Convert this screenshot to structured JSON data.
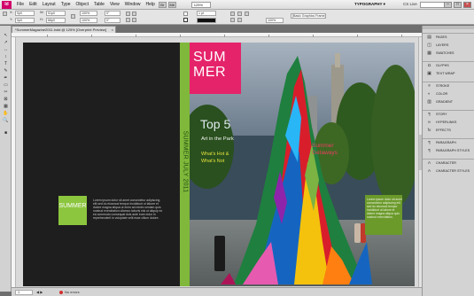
{
  "app": {
    "logo": "Id"
  },
  "menu": [
    "File",
    "Edit",
    "Layout",
    "Type",
    "Object",
    "Table",
    "View",
    "Window",
    "Help"
  ],
  "bridge": [
    "Br",
    "Mb"
  ],
  "zoom": "125%",
  "workspace": "TYPOGRAPHY ▾",
  "live": "CS Live",
  "window_buttons": [
    "–",
    "□",
    "×"
  ],
  "control_panel": {
    "ref_x": "0p0",
    "ref_y": "0p0",
    "w": "51p0",
    "h": "66p0",
    "scale_x": "100%",
    "scale_y": "100%",
    "angle": "0°",
    "shear": "0°",
    "stroke_weight": "1 pt",
    "frame_style": "[Basic Graphics Frame]",
    "zoom2": "100%"
  },
  "document_tab": {
    "title": "*SummerMagazine2011.indd @ 125% [Overprint Preview]",
    "close": "×"
  },
  "tools": [
    "↖",
    "↗",
    "↔",
    "↕",
    "T",
    "✎",
    "✒",
    "▭",
    "✂",
    "⊠",
    "▦",
    "✋",
    "🔍",
    "■"
  ],
  "back_cover": {
    "summer_box": "SUMMER",
    "copy": "Lorem ipsum dolor sit amet consectetur adipiscing elit sed do eiusmod tempor incididunt ut labore et dolore magna aliqua ut enim ad minim veniam quis nostrud exercitation ullamco laboris nisi ut aliquip ex ea commodo consequat duis aute irure dolor in reprehenderit in voluptate velit esse cillum dolore."
  },
  "spine": {
    "text": "SUMMER JULY 2011"
  },
  "front_cover": {
    "masthead": "SUMMER",
    "top5": "Top 5",
    "art_park": "Art in the Park",
    "whats_hot": "What's Hot &",
    "whats_not": "What's Not",
    "getaways_1": "Summer",
    "getaways_2": "Getaways",
    "right_copy": "Lorem ipsum dolor sit amet consectetur adipiscing elit sed do eiusmod tempor incididunt ut labore et dolore magna aliqua quis nostrud exercitation."
  },
  "status": {
    "page": "1",
    "preflight": "No errors",
    "zoom_nav": "◀ ▶"
  },
  "panels": [
    [
      {
        "label": "PAGES",
        "icon": "▤"
      },
      {
        "label": "LAYERS",
        "icon": "◫"
      },
      {
        "label": "SWATCHES",
        "icon": "▦"
      }
    ],
    [
      {
        "label": "GLYPHS",
        "icon": "Ω"
      },
      {
        "label": "TEXT WRAP",
        "icon": "▣"
      }
    ],
    [
      {
        "label": "STROKE",
        "icon": "≡"
      },
      {
        "label": "COLOR",
        "icon": "◐"
      },
      {
        "label": "GRADIENT",
        "icon": "▥"
      }
    ],
    [
      {
        "label": "STORY",
        "icon": "¶"
      },
      {
        "label": "HYPERLINKS",
        "icon": "∞"
      },
      {
        "label": "EFFECTS",
        "icon": "fx"
      }
    ],
    [
      {
        "label": "PARAGRAPH",
        "icon": "¶"
      },
      {
        "label": "PARAGRAPH STYLES",
        "icon": "¶"
      }
    ],
    [
      {
        "label": "CHARACTER",
        "icon": "A"
      },
      {
        "label": "CHARACTER STYLES",
        "icon": "A"
      }
    ]
  ]
}
